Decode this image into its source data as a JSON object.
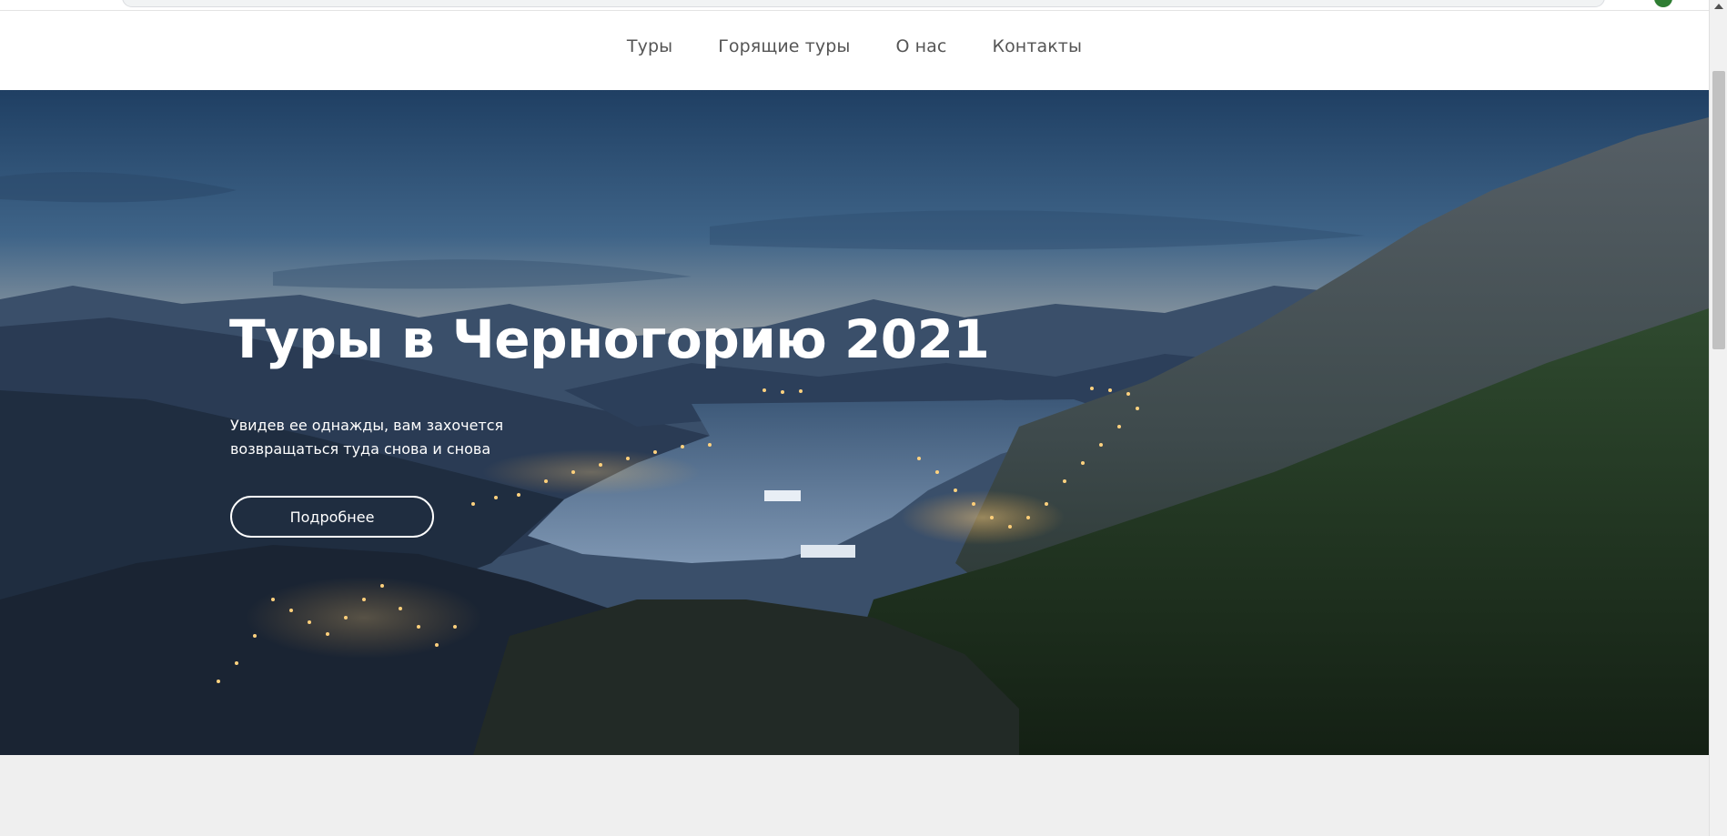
{
  "nav": {
    "items": [
      {
        "label": "Туры"
      },
      {
        "label": "Горящие туры"
      },
      {
        "label": "О нас"
      },
      {
        "label": "Контакты"
      }
    ]
  },
  "hero": {
    "title": "Туры в Черногорию 2021",
    "subtitle": "Увидев ее однажды, вам захочется возвращаться туда снова и снова",
    "button_label": "Подробнее",
    "image_description_icon": "bay-of-kotor-night-photo"
  },
  "colors": {
    "header_bg": "#ffffff",
    "nav_text": "#555555",
    "hero_text": "#ffffff",
    "page_bg": "#efefef"
  }
}
